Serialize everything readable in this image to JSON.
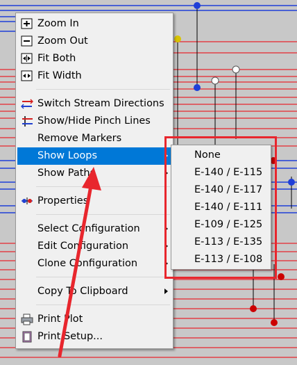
{
  "main_menu": {
    "items": [
      {
        "label": "Zoom In",
        "icon": "zoom-in-icon"
      },
      {
        "label": "Zoom Out",
        "icon": "zoom-out-icon"
      },
      {
        "label": "Fit Both",
        "icon": "fit-both-icon"
      },
      {
        "label": "Fit Width",
        "icon": "fit-width-icon"
      },
      {
        "label": "Switch Stream Directions",
        "icon": "switch-streams-icon"
      },
      {
        "label": "Show/Hide Pinch Lines",
        "icon": "pinch-lines-icon"
      },
      {
        "label": "Remove Markers"
      },
      {
        "label": "Show Loops",
        "highlighted": true,
        "has_submenu": true
      },
      {
        "label": "Show Paths",
        "has_submenu": true
      },
      {
        "label": "Properties",
        "icon": "properties-icon"
      },
      {
        "label": "Select Configuration",
        "has_submenu": true
      },
      {
        "label": "Edit Configuration",
        "has_submenu": true
      },
      {
        "label": "Clone Configuration",
        "has_submenu": true
      },
      {
        "label": "Copy To Clipboard",
        "has_submenu": true
      },
      {
        "label": "Print Plot",
        "icon": "printer-icon"
      },
      {
        "label": "Print Setup...",
        "icon": "print-setup-icon"
      }
    ]
  },
  "submenu": {
    "items": [
      "None",
      "E-140 / E-115",
      "E-140 / E-117",
      "E-140 / E-111",
      "E-109 / E-125",
      "E-113 / E-135",
      "E-113 / E-108"
    ]
  },
  "colors": {
    "highlight": "#0078d7",
    "annotation": "#e8262d",
    "hot_stream": "#e8262d",
    "cold_stream": "#1f3fd8",
    "background": "#c8c8c8"
  }
}
